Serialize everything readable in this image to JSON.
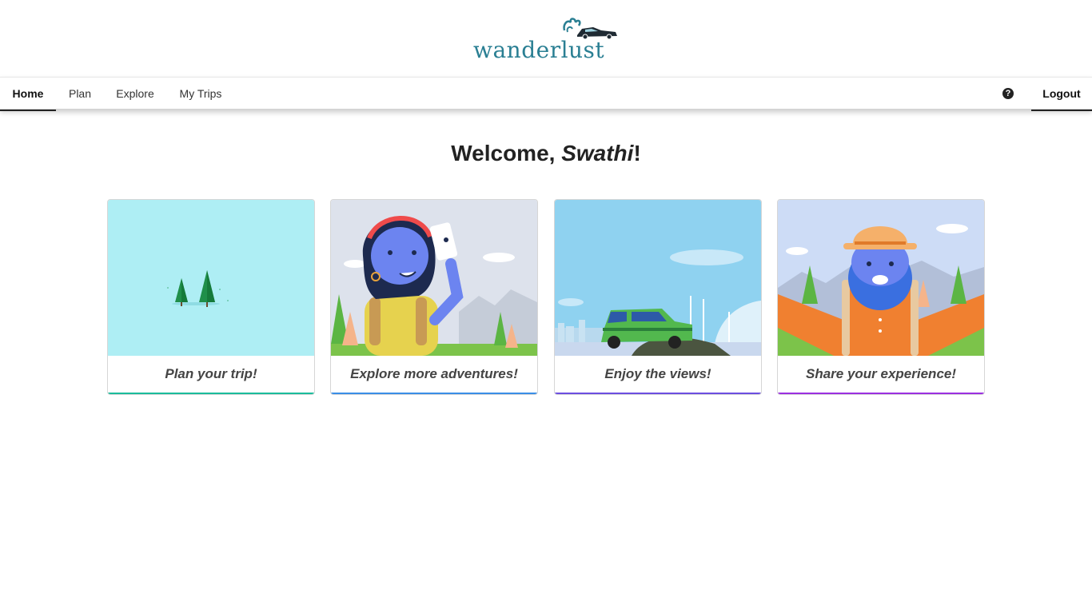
{
  "brand": {
    "name": "Wanderlust",
    "logo_text": "wanderlust",
    "logo_color": "#2a7f93"
  },
  "nav": {
    "items": [
      {
        "label": "Home",
        "active": true
      },
      {
        "label": "Plan",
        "active": false
      },
      {
        "label": "Explore",
        "active": false
      },
      {
        "label": "My Trips",
        "active": false
      }
    ],
    "help_icon": "question-circle-icon",
    "logout_label": "Logout"
  },
  "welcome": {
    "prefix": "Welcome, ",
    "name": "Swathi",
    "suffix": "!"
  },
  "cards": [
    {
      "caption": "Plan your trip!",
      "accent": "#1abc9c",
      "art": "pine-trees-illustration"
    },
    {
      "caption": "Explore more adventures!",
      "accent": "#3a8ee6",
      "art": "girl-selfie-illustration"
    },
    {
      "caption": "Enjoy the views!",
      "accent": "#6c4ee0",
      "art": "car-road-trip-illustration"
    },
    {
      "caption": "Share your experience!",
      "accent": "#9b30e0",
      "art": "bearded-traveler-illustration"
    }
  ]
}
